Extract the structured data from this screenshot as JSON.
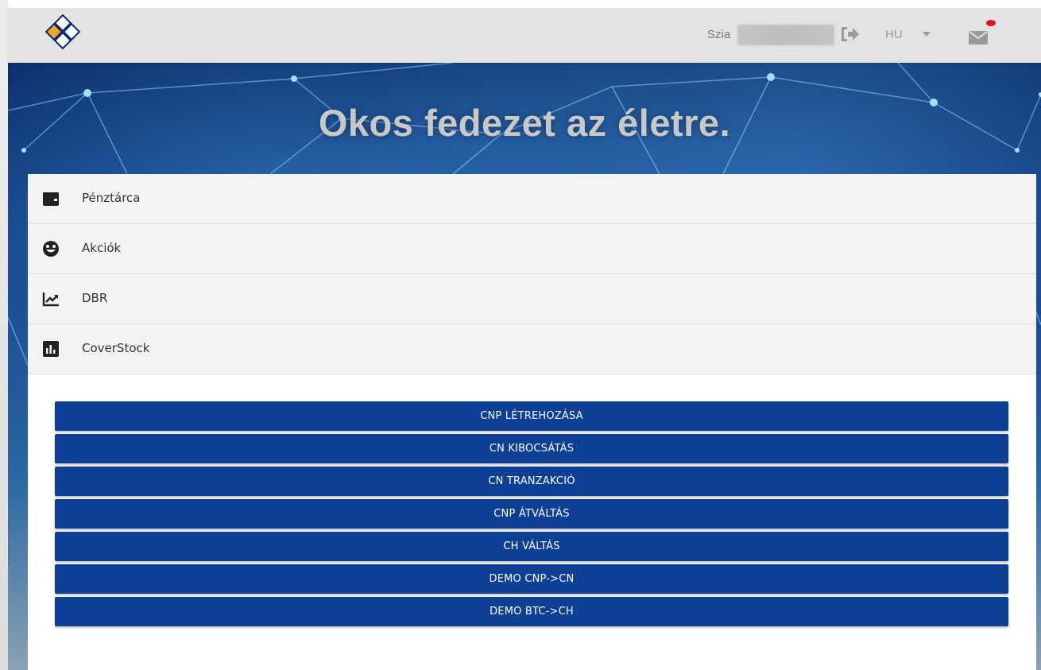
{
  "header": {
    "greeting": "Szia",
    "language": "HU",
    "colors": {
      "bar": "#e3e3e3",
      "notification_dot": "#e8121b"
    }
  },
  "hero": {
    "title": "Okos fedezet az életre."
  },
  "menu": {
    "items": [
      {
        "label": "Pénztárca",
        "icon": "wallet-icon"
      },
      {
        "label": "Akciók",
        "icon": "smiley-icon"
      },
      {
        "label": "DBR",
        "icon": "trending-up-icon"
      },
      {
        "label": "CoverStock",
        "icon": "bar-chart-icon"
      }
    ]
  },
  "actions": {
    "buttons": [
      "CNP LÉTREHOZÁSA",
      "CN KIBOCSÁTÁS",
      "CN TRANZAKCIÓ",
      "CNP ÁTVÁLTÁS",
      "CH VÁLTÁS",
      "DEMO CNP->CN",
      "DEMO BTC->CH"
    ],
    "color": "#0d3f97"
  }
}
